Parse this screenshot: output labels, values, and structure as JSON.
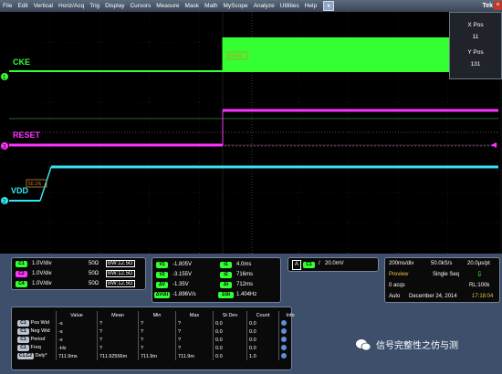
{
  "menu": {
    "items": [
      "File",
      "Edit",
      "Vertical",
      "Horiz/Acq",
      "Trig",
      "Display",
      "Cursors",
      "Measure",
      "Mask",
      "Math",
      "MyScope",
      "Analyze",
      "Utilities",
      "Help"
    ],
    "brand": "Tek"
  },
  "position_panel": {
    "x_label": "X Pos",
    "x_value": "11",
    "y_label": "Y Pos",
    "y_value": "131"
  },
  "channels": [
    {
      "label": "CKE",
      "color": "#33ff33",
      "marker": "1"
    },
    {
      "label": "RESET",
      "color": "#ff33ff",
      "marker": "3"
    },
    {
      "label": "VDD",
      "color": "#33e6f0",
      "marker": "2"
    }
  ],
  "annotations": {
    "cke_ref": "50.0%",
    "vdd_ref": "50.1%"
  },
  "vertical": [
    {
      "tag": "C1",
      "scale": "1.0V/div",
      "imp": "50Ω",
      "bw": "B",
      "bw_val": "W:12.5G",
      "color": "#33ff33"
    },
    {
      "tag": "C2",
      "scale": "1.0V/div",
      "imp": "50Ω",
      "bw": "B",
      "bw_val": "W:12.5G",
      "color": "#ff33ff"
    },
    {
      "tag": "C4",
      "scale": "1.0V/div",
      "imp": "50Ω",
      "bw": "B",
      "bw_val": "W:12.5G",
      "color": "#33ff33"
    }
  ],
  "cursors": [
    {
      "tag": "V1",
      "val": "-1.805V",
      "tag2": "t1",
      "val2": "4.0ms"
    },
    {
      "tag": "V2",
      "val": "-3.155V",
      "tag2": "t2",
      "val2": "716ms"
    },
    {
      "tag": "ΔV",
      "val": "-1.35V",
      "tag2": "Δt",
      "val2": "712ms"
    },
    {
      "tag": "ΔV/Δt",
      "val": "-1.896V/s",
      "tag2": "1/Δt",
      "val2": "1.404Hz"
    }
  ],
  "trigger": {
    "tag": "C1",
    "slope": "/",
    "level": "20.0mV"
  },
  "acquisition": {
    "timebase": "200ms/div",
    "rate": "50.0kS/s",
    "per_pt": "20.0μs/pt",
    "mode": "Preview",
    "seq": "Single Seq",
    "acqs": "0 acqs",
    "rl": "RL:100k",
    "auto": "Auto",
    "date": "December 24, 2014",
    "time": "17:18:04"
  },
  "measurements": {
    "headers": [
      "",
      "Value",
      "Mean",
      "Min",
      "Max",
      "St Dev",
      "Count",
      "Info"
    ],
    "rows": [
      {
        "tag": "C1",
        "name": "Pos Wid",
        "value": "-s",
        "mean": "?",
        "min": "?",
        "max": "?",
        "stdev": "0.0",
        "count": "0.0"
      },
      {
        "tag": "C1",
        "name": "Neg Wid",
        "value": "-s",
        "mean": "?",
        "min": "?",
        "max": "?",
        "stdev": "0.0",
        "count": "0.0"
      },
      {
        "tag": "C1",
        "name": "Period",
        "value": "-s",
        "mean": "?",
        "min": "?",
        "max": "?",
        "stdev": "0.0",
        "count": "0.0"
      },
      {
        "tag": "C1",
        "name": "Freq",
        "value": "-Hz",
        "mean": "?",
        "min": "?",
        "max": "?",
        "stdev": "0.0",
        "count": "0.0"
      },
      {
        "tag": "C1,C2",
        "name": "Dely*",
        "value": "711.9ms",
        "mean": "711.92556m",
        "min": "711.9m",
        "max": "711.9m",
        "stdev": "0.0",
        "count": "1.0"
      }
    ]
  },
  "watermark": "信号完整性之仿与测"
}
